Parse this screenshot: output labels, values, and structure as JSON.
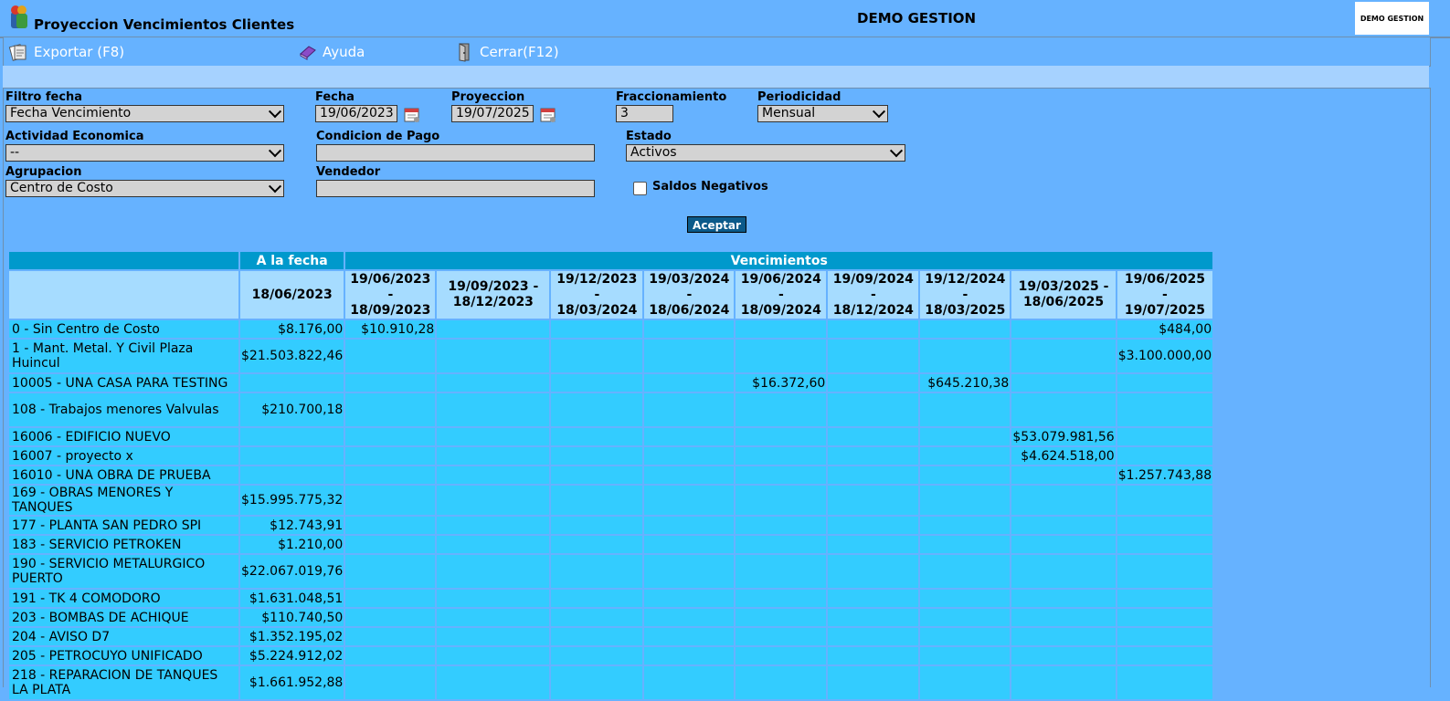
{
  "window": {
    "title": "Proyeccion Vencimientos Clientes",
    "company": "DEMO GESTION",
    "logo_text": "DEMO GESTION"
  },
  "toolbar": {
    "export_label": "Exportar (F8)",
    "help_label": "Ayuda",
    "close_label": "Cerrar(F12)"
  },
  "filters": {
    "filtro_fecha": {
      "label": "Filtro fecha",
      "value": "Fecha Vencimiento"
    },
    "fecha": {
      "label": "Fecha",
      "value": "19/06/2023"
    },
    "proyeccion": {
      "label": "Proyeccion",
      "value": "19/07/2025"
    },
    "fraccionamiento": {
      "label": "Fraccionamiento",
      "value": "3"
    },
    "periodicidad": {
      "label": "Periodicidad",
      "value": "Mensual"
    },
    "actividad": {
      "label": "Actividad Economica",
      "value": "--"
    },
    "condicion": {
      "label": "Condicion de Pago",
      "value": ""
    },
    "estado": {
      "label": "Estado",
      "value": "Activos"
    },
    "agrupacion": {
      "label": "Agrupacion",
      "value": "Centro de Costo"
    },
    "vendedor": {
      "label": "Vendedor",
      "value": ""
    },
    "saldos_negativos": {
      "label": "Saldos Negativos",
      "checked": false
    },
    "accept_label": "Aceptar"
  },
  "table": {
    "header_a_la_fecha": "A la fecha",
    "header_vencimientos": "Vencimientos",
    "a_la_fecha_date": "18/06/2023",
    "periods": [
      {
        "l1": "19/06/2023",
        "l2": "-",
        "l3": "18/09/2023"
      },
      {
        "l1": "19/09/2023 -",
        "l2": "18/12/2023",
        "l3": ""
      },
      {
        "l1": "19/12/2023",
        "l2": "-",
        "l3": "18/03/2024"
      },
      {
        "l1": "19/03/2024",
        "l2": "-",
        "l3": "18/06/2024"
      },
      {
        "l1": "19/06/2024",
        "l2": "-",
        "l3": "18/09/2024"
      },
      {
        "l1": "19/09/2024",
        "l2": "-",
        "l3": "18/12/2024"
      },
      {
        "l1": "19/12/2024",
        "l2": "-",
        "l3": "18/03/2025"
      },
      {
        "l1": "19/03/2025 -",
        "l2": "18/06/2025",
        "l3": ""
      },
      {
        "l1": "19/06/2025",
        "l2": "-",
        "l3": "19/07/2025"
      }
    ],
    "rows": [
      {
        "name": "0 - Sin Centro de Costo",
        "a": "$8.176,00",
        "p": [
          "$10.910,28",
          "",
          "",
          "",
          "",
          "",
          "",
          "",
          "$484,00"
        ]
      },
      {
        "name": "1 - Mant. Metal. Y Civil Plaza Huincul",
        "a": "$21.503.822,46",
        "p": [
          "",
          "",
          "",
          "",
          "",
          "",
          "",
          "",
          "$3.100.000,00"
        ]
      },
      {
        "name": "10005 - UNA CASA PARA TESTING",
        "a": "",
        "p": [
          "",
          "",
          "",
          "",
          "$16.372,60",
          "",
          "$645.210,38",
          "",
          ""
        ]
      },
      {
        "name": "108 - Trabajos menores Valvulas",
        "a": "$210.700,18",
        "p": [
          "",
          "",
          "",
          "",
          "",
          "",
          "",
          "",
          ""
        ]
      },
      {
        "name": "16006 - EDIFICIO NUEVO",
        "a": "",
        "p": [
          "",
          "",
          "",
          "",
          "",
          "",
          "",
          "$53.079.981,56",
          ""
        ]
      },
      {
        "name": "16007 - proyecto x",
        "a": "",
        "p": [
          "",
          "",
          "",
          "",
          "",
          "",
          "",
          "$4.624.518,00",
          ""
        ]
      },
      {
        "name": "16010 - UNA OBRA DE PRUEBA",
        "a": "",
        "p": [
          "",
          "",
          "",
          "",
          "",
          "",
          "",
          "",
          "$1.257.743,88"
        ]
      },
      {
        "name": "169 - OBRAS MENORES Y TANQUES",
        "a": "$15.995.775,32",
        "p": [
          "",
          "",
          "",
          "",
          "",
          "",
          "",
          "",
          ""
        ]
      },
      {
        "name": "177 - PLANTA SAN PEDRO SPI",
        "a": "$12.743,91",
        "p": [
          "",
          "",
          "",
          "",
          "",
          "",
          "",
          "",
          ""
        ]
      },
      {
        "name": "183 - SERVICIO PETROKEN",
        "a": "$1.210,00",
        "p": [
          "",
          "",
          "",
          "",
          "",
          "",
          "",
          "",
          ""
        ]
      },
      {
        "name": "190 - SERVICIO METALURGICO PUERTO",
        "a": "$22.067.019,76",
        "p": [
          "",
          "",
          "",
          "",
          "",
          "",
          "",
          "",
          ""
        ]
      },
      {
        "name": "191 - TK 4 COMODORO",
        "a": "$1.631.048,51",
        "p": [
          "",
          "",
          "",
          "",
          "",
          "",
          "",
          "",
          ""
        ]
      },
      {
        "name": "203 - BOMBAS DE ACHIQUE",
        "a": "$110.740,50",
        "p": [
          "",
          "",
          "",
          "",
          "",
          "",
          "",
          "",
          ""
        ]
      },
      {
        "name": "204 - AVISO D7",
        "a": "$1.352.195,02",
        "p": [
          "",
          "",
          "",
          "",
          "",
          "",
          "",
          "",
          ""
        ]
      },
      {
        "name": "205 - PETROCUYO UNIFICADO",
        "a": "$5.224.912,02",
        "p": [
          "",
          "",
          "",
          "",
          "",
          "",
          "",
          "",
          ""
        ]
      },
      {
        "name": "218 - REPARACION DE TANQUES LA PLATA",
        "a": "$1.661.952,88",
        "p": [
          "",
          "",
          "",
          "",
          "",
          "",
          "",
          "",
          ""
        ]
      }
    ]
  }
}
